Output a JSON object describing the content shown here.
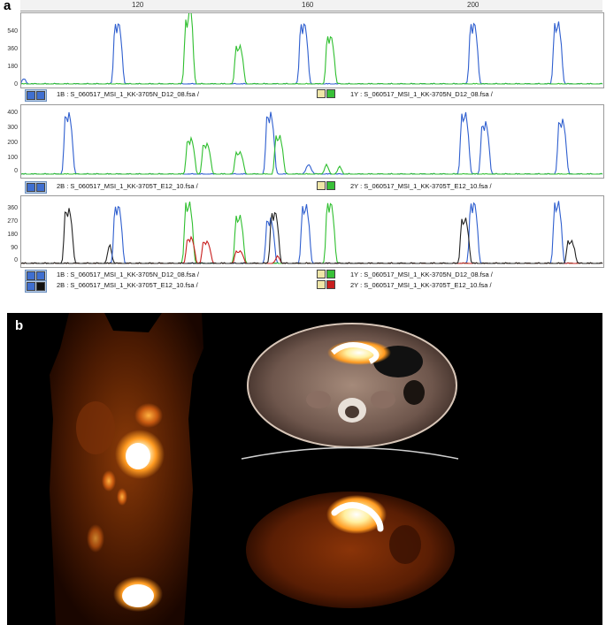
{
  "figure": {
    "panel_a_label": "a",
    "panel_b_label": "b",
    "ruler_ticks": [
      "120",
      "160",
      "200"
    ]
  },
  "electropherogram": {
    "panels": [
      {
        "yticks": [
          "540",
          "360",
          "180",
          "0"
        ],
        "legend": [
          {
            "left": "1B : S_060517_MSI_1_KK-3705N_D12_08.fsa /",
            "right": "1Y : S_060517_MSI_1_KK-3705N_D12_08.fsa /"
          }
        ]
      },
      {
        "yticks": [
          "400",
          "300",
          "200",
          "100",
          "0"
        ],
        "legend": [
          {
            "left": "2B : S_060517_MSI_1_KK-3705T_E12_10.fsa /",
            "right": "2Y : S_060517_MSI_1_KK-3705T_E12_10.fsa /"
          }
        ]
      },
      {
        "yticks": [
          "360",
          "270",
          "180",
          "90",
          "0"
        ],
        "legend": [
          {
            "left": "1B : S_060517_MSI_1_KK-3705N_D12_08.fsa /",
            "right": "1Y : S_060517_MSI_1_KK-3705N_D12_08.fsa /"
          },
          {
            "left": "2B : S_060517_MSI_1_KK-3705T_E12_10.fsa /",
            "right": "2Y : S_060517_MSI_1_KK-3705T_E12_10.fsa /"
          }
        ]
      }
    ],
    "colors": {
      "blue": "#2f5fcf",
      "green": "#2fbf2f",
      "black": "#222222",
      "red": "#c81e1e"
    }
  },
  "imaging": {
    "colormap": "hot (black-red-orange-white)"
  }
}
